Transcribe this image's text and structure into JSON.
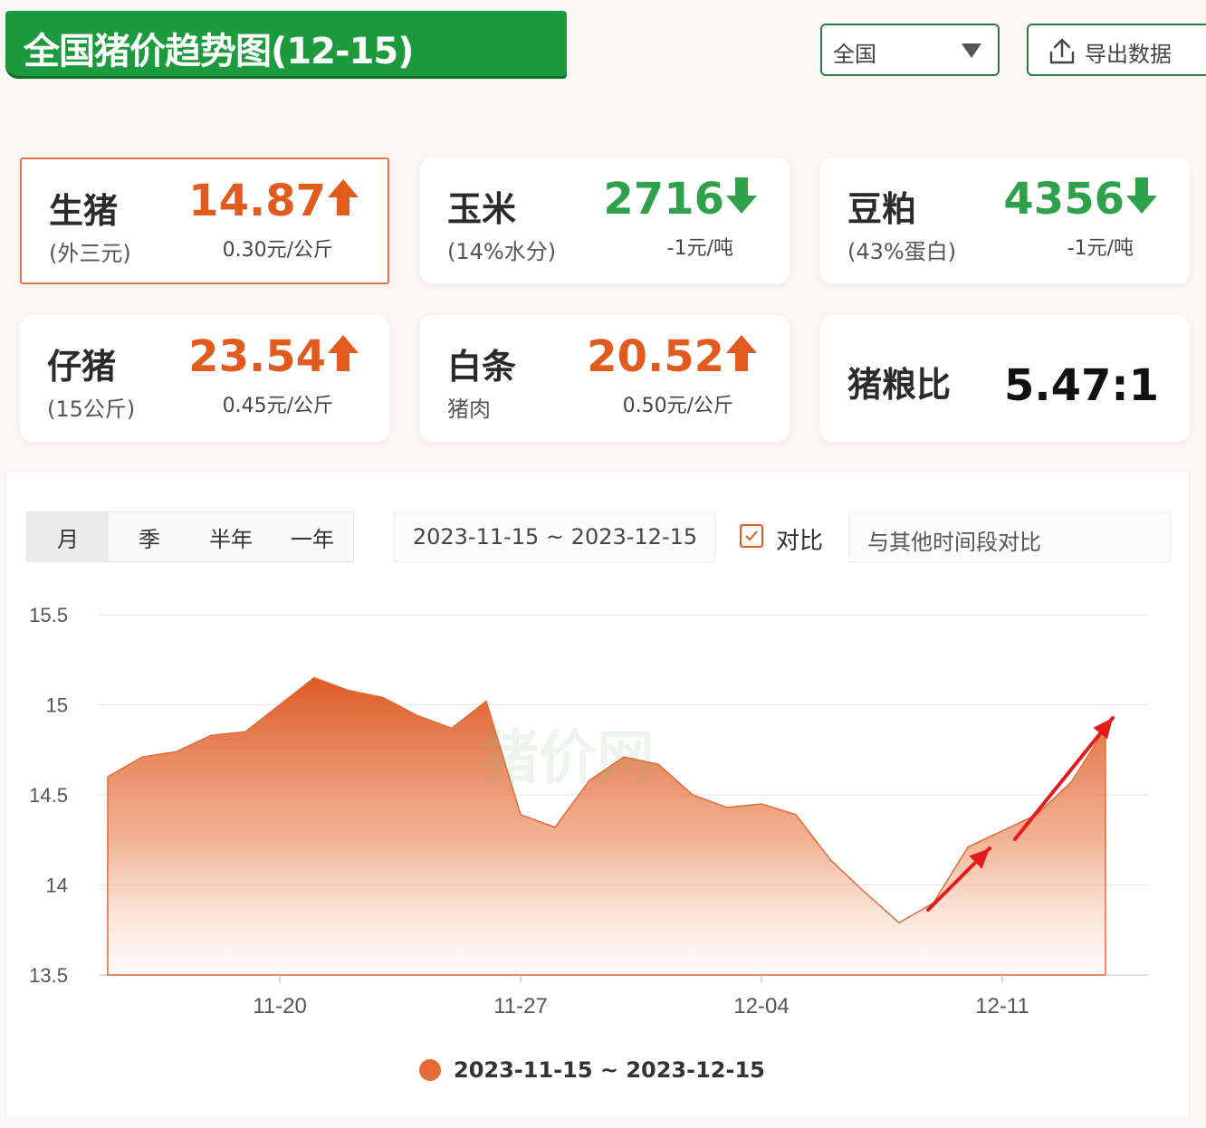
{
  "header": {
    "title": "全国猪价趋势图(12-15)",
    "region_select": "全国",
    "export_label": "导出数据"
  },
  "cards": [
    {
      "name": "生猪",
      "sub": "(外三元)",
      "price": "14.87",
      "trend": "up",
      "change": "0.30元/公斤"
    },
    {
      "name": "玉米",
      "sub": "(14%水分)",
      "price": "2716",
      "trend": "down",
      "change": "-1元/吨"
    },
    {
      "name": "豆粕",
      "sub": "(43%蛋白)",
      "price": "4356",
      "trend": "down",
      "change": "-1元/吨"
    },
    {
      "name": "仔猪",
      "sub": "(15公斤)",
      "price": "23.54",
      "trend": "up",
      "change": "0.45元/公斤"
    },
    {
      "name": "白条",
      "sub": "猪肉",
      "price": "20.52",
      "trend": "up",
      "change": "0.50元/公斤"
    },
    {
      "name": "猪粮比",
      "ratio": "5.47:1"
    }
  ],
  "controls": {
    "periods": [
      "月",
      "季",
      "半年",
      "一年"
    ],
    "active_period": "月",
    "date_range": "2023-11-15 ~ 2023-12-15",
    "compare_checked": true,
    "compare_label": "对比",
    "compare_placeholder": "与其他时间段对比"
  },
  "colors": {
    "brand_green": "#1d9a3e",
    "up": "#e25b1e",
    "down": "#2fa14a",
    "series": "#e56a35",
    "annotation_arrow": "#e31b1b"
  },
  "watermark": "猪价网",
  "chart_data": {
    "type": "area",
    "x": [
      "2023-11-15",
      "2023-11-16",
      "2023-11-17",
      "2023-11-18",
      "2023-11-19",
      "2023-11-20",
      "2023-11-21",
      "2023-11-22",
      "2023-11-23",
      "2023-11-24",
      "2023-11-25",
      "2023-11-26",
      "2023-11-27",
      "2023-11-28",
      "2023-11-29",
      "2023-11-30",
      "2023-12-01",
      "2023-12-02",
      "2023-12-03",
      "2023-12-04",
      "2023-12-05",
      "2023-12-06",
      "2023-12-07",
      "2023-12-08",
      "2023-12-09",
      "2023-12-10",
      "2023-12-11",
      "2023-12-12",
      "2023-12-13",
      "2023-12-14",
      "2023-12-15"
    ],
    "series": [
      {
        "name": "2023-11-15 ~ 2023-12-15",
        "values": [
          14.6,
          14.71,
          14.74,
          14.83,
          14.85,
          15.0,
          15.15,
          15.08,
          15.04,
          14.94,
          14.87,
          15.02,
          14.39,
          14.32,
          14.58,
          14.71,
          14.67,
          14.5,
          14.43,
          14.45,
          14.39,
          14.14,
          13.96,
          13.79,
          13.9,
          14.21,
          14.3,
          14.39,
          14.57,
          14.87
        ]
      }
    ],
    "x_ticks": [
      "11-20",
      "11-27",
      "12-04",
      "12-11"
    ],
    "y_ticks": [
      13.5,
      14,
      14.5,
      15,
      15.5
    ],
    "ylim": [
      13.5,
      15.5
    ],
    "grid": true,
    "legend_position": "bottom-center"
  }
}
